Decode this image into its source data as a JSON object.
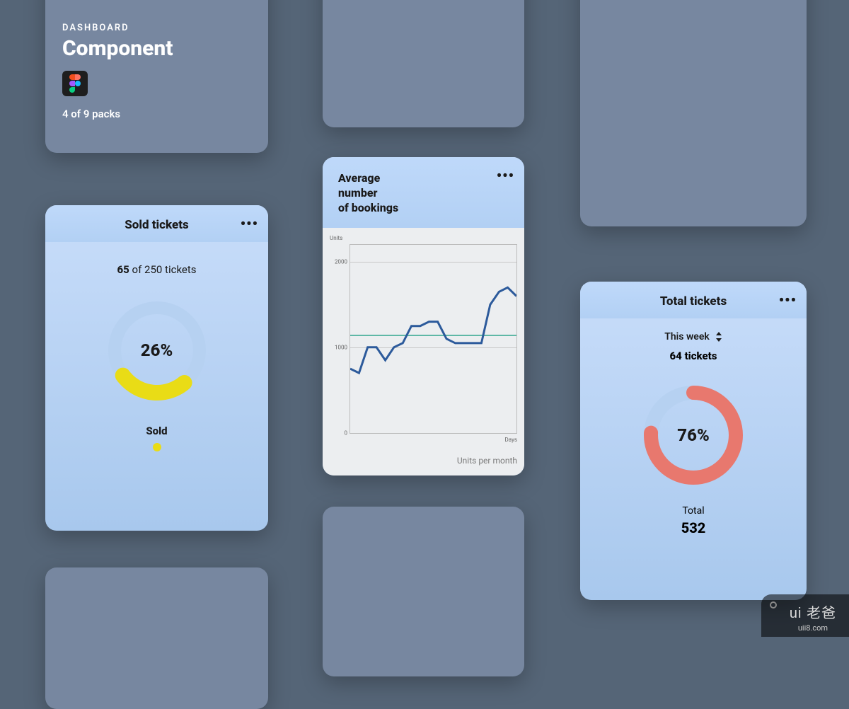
{
  "intro": {
    "eyebrow": "DASHBOARD",
    "title": "Component",
    "packs": "4 of 9 packs"
  },
  "sold": {
    "title": "Sold tickets",
    "count_bold": "65",
    "count_rest": " of 250 tickets",
    "percent": "26%",
    "legend": "Sold"
  },
  "bookings": {
    "title_l1": "Average",
    "title_l2": "number",
    "title_l3": "of bookings",
    "y_unit": "Units",
    "x_unit": "Days",
    "caption": "Units per month",
    "ticks": {
      "t0": "0",
      "t1000": "1000",
      "t2000": "2000"
    }
  },
  "total": {
    "title": "Total tickets",
    "period": "This week",
    "count": "64 tickets",
    "percent": "76%",
    "legend_label": "Total",
    "legend_value": "532"
  },
  "watermark": {
    "brand": "ui 老爸",
    "url": "uii8.com"
  },
  "colors": {
    "yellow": "#e9dc16",
    "ring_bg": "#b6d1f1",
    "coral": "#e8786e",
    "guide": "#5fb8a6",
    "line": "#2c5a9b"
  },
  "chart_data": {
    "type": "line",
    "title": "Average number of bookings",
    "xlabel": "Days",
    "ylabel": "Units",
    "caption": "Units per month",
    "ylim": [
      0,
      2200
    ],
    "yticks": [
      0,
      1000,
      2000
    ],
    "guide_value": 1150,
    "x": [
      1,
      2,
      3,
      4,
      5,
      6,
      7,
      8,
      9,
      10,
      11,
      12,
      13,
      14,
      15,
      16,
      17,
      18,
      19,
      20
    ],
    "values": [
      750,
      700,
      1000,
      1000,
      850,
      1000,
      1050,
      1250,
      1250,
      1300,
      1300,
      1100,
      1050,
      1050,
      1050,
      1050,
      1500,
      1650,
      1700,
      1600
    ]
  }
}
